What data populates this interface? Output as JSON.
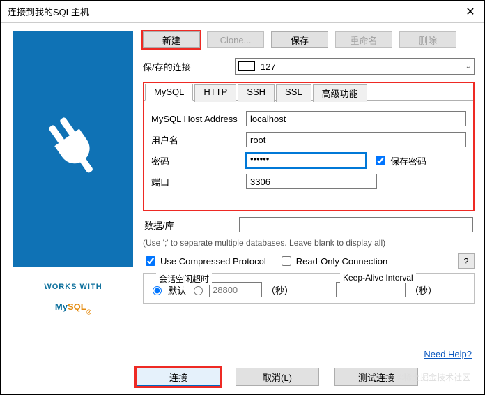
{
  "title": "连接到我的SQL主机",
  "toolbar": {
    "new": "新建",
    "clone": "Clone...",
    "save": "保存",
    "rename": "重命名",
    "delete": "删除"
  },
  "saved_connection": {
    "label": "保/存的连接",
    "value": "127"
  },
  "tabs": [
    "MySQL",
    "HTTP",
    "SSH",
    "SSL",
    "高级功能"
  ],
  "fields": {
    "host_label": "MySQL Host Address",
    "host_value": "localhost",
    "user_label": "用户名",
    "user_value": "root",
    "pass_label": "密码",
    "pass_value": "••••••",
    "save_pass": "保存密码",
    "port_label": "端口",
    "port_value": "3306",
    "db_label": "数据/库",
    "db_value": ""
  },
  "hint": "(Use ';' to separate multiple databases. Leave blank to display all)",
  "options": {
    "compressed": "Use Compressed Protocol",
    "readonly": "Read-Only Connection",
    "help_btn": "?"
  },
  "session": {
    "idle_title": "会话空闲超时",
    "default_radio": "默认",
    "custom_placeholder": "28800",
    "seconds": "（秒）",
    "keepalive_title": "Keep-Alive Interval",
    "keepalive_value": ""
  },
  "need_help": "Need Help?",
  "footer": {
    "connect": "连接",
    "cancel": "取消(L)",
    "test": "测试连接"
  },
  "watermark": "©稀土掘金技术社区",
  "logo": {
    "works": "WORKS WITH",
    "my": "My",
    "sql": "SQL"
  }
}
